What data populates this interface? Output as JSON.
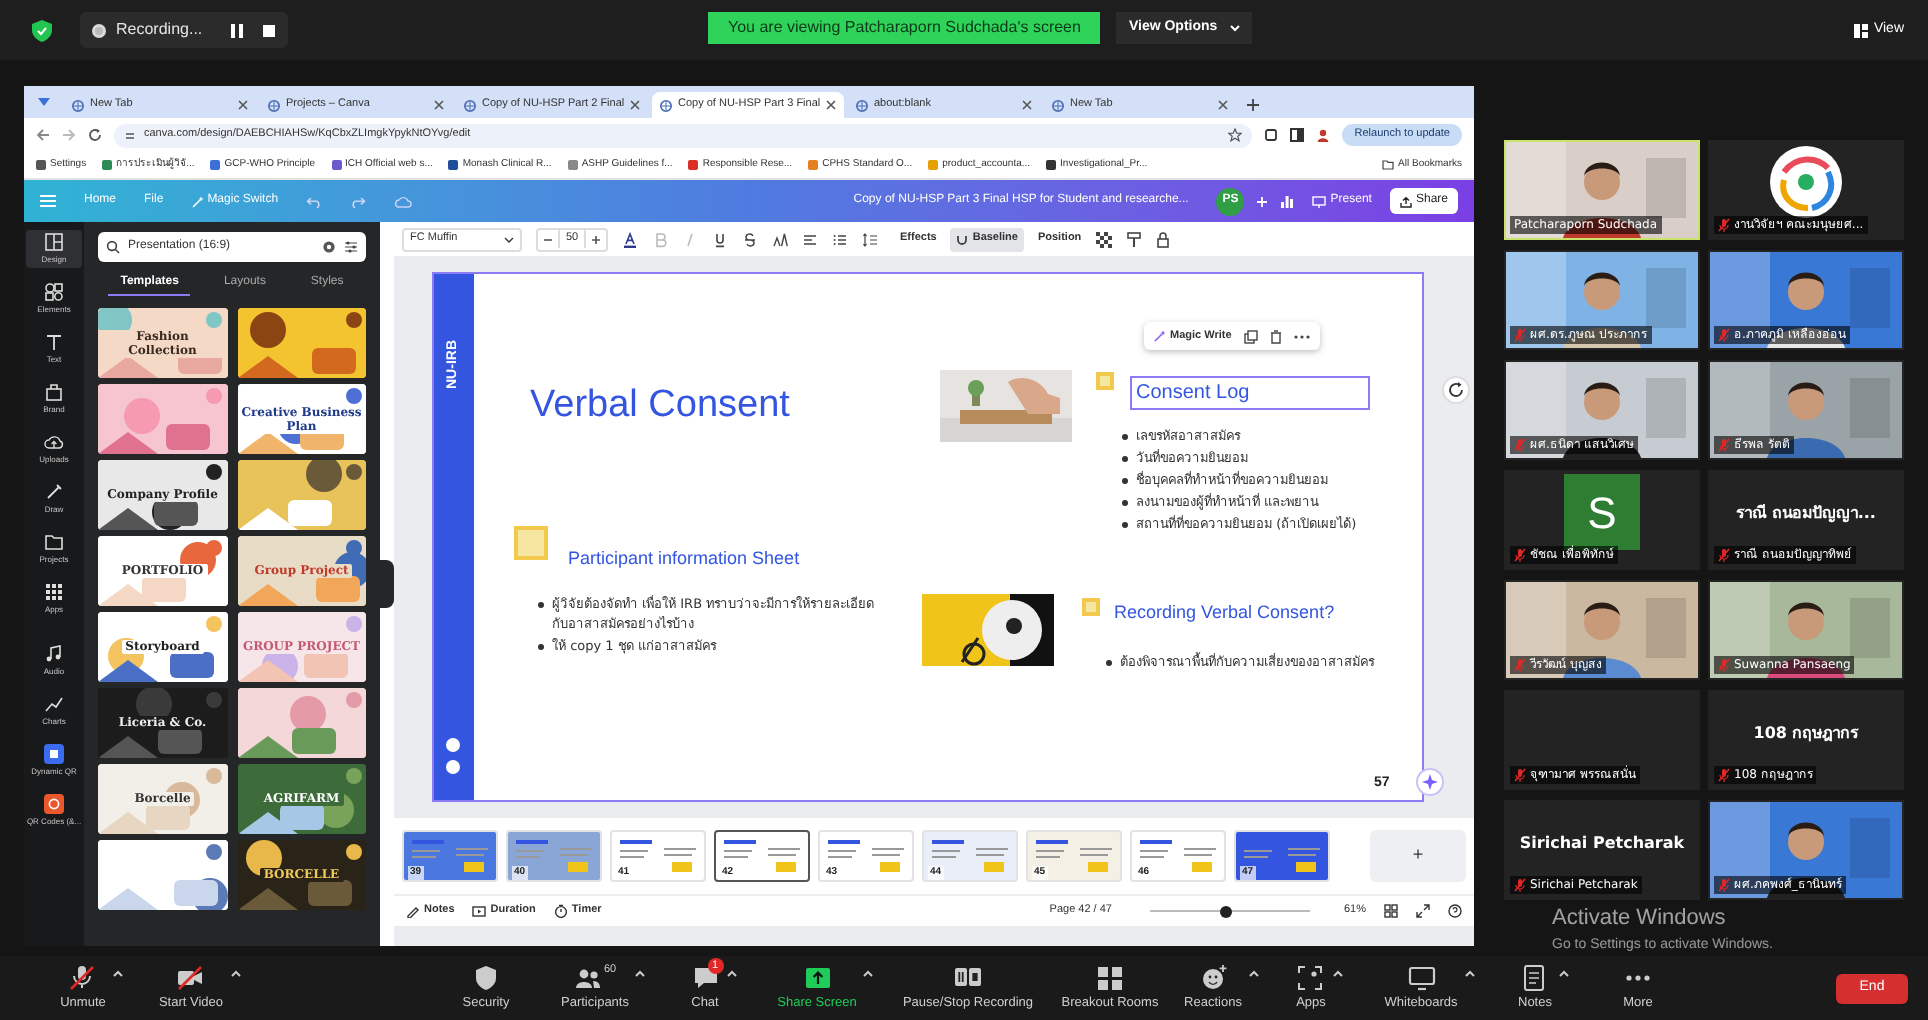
{
  "meeting_bar": {
    "recording": "Recording...",
    "banner": "You are viewing Patcharaporn Sudchada's screen",
    "view_options": "View Options",
    "view": "View"
  },
  "browser": {
    "tabs": [
      {
        "label": "New Tab",
        "selected": false
      },
      {
        "label": "Projects – Canva",
        "selected": false
      },
      {
        "label": "Copy of NU-HSP Part 2 Final",
        "selected": false
      },
      {
        "label": "Copy of NU-HSP Part 3 Final",
        "selected": true
      },
      {
        "label": "about:blank",
        "selected": false
      },
      {
        "label": "New Tab",
        "selected": false
      }
    ],
    "url": "canva.com/design/DAEBCHIAHSw/KqCbxZLImgkYpykNtOYvg/edit",
    "relaunch": "Relaunch to update",
    "bookmarks": [
      "Settings",
      "การประเมินผู้วิจั...",
      "GCP-WHO Principle",
      "ICH Official web s...",
      "Monash Clinical R...",
      "ASHP Guidelines f...",
      "Responsible Rese...",
      "CPHS Standard O...",
      "product_accounta...",
      "Investigational_Pr..."
    ],
    "all_bookmarks": "All Bookmarks"
  },
  "canva": {
    "header": {
      "menu": [
        "Home",
        "File",
        "Magic Switch"
      ],
      "title": "Copy of NU-HSP Part 3 Final HSP for Student and researche...",
      "avatar": "PS",
      "present": "Present",
      "share": "Share"
    },
    "rail": [
      {
        "kind": "design",
        "label": "Design",
        "selected": true
      },
      {
        "kind": "elements",
        "label": "Elements",
        "selected": false
      },
      {
        "kind": "text",
        "label": "Text",
        "selected": false
      },
      {
        "kind": "brand",
        "label": "Brand",
        "selected": false
      },
      {
        "kind": "uploads",
        "label": "Uploads",
        "selected": false
      },
      {
        "kind": "draw",
        "label": "Draw",
        "selected": false
      },
      {
        "kind": "projects",
        "label": "Projects",
        "selected": false
      },
      {
        "kind": "apps",
        "label": "Apps",
        "selected": false
      },
      {
        "kind": "audio",
        "label": "Audio",
        "selected": false
      },
      {
        "kind": "charts",
        "label": "Charts",
        "selected": false
      },
      {
        "kind": "qr",
        "label": "Dynamic QR",
        "selected": false
      },
      {
        "kind": "qrcodes",
        "label": "QR Codes (&...",
        "selected": false
      }
    ],
    "panel": {
      "search": "Presentation (16:9)",
      "tabs": [
        {
          "label": "Templates",
          "selected": true
        },
        {
          "label": "Layouts",
          "selected": false
        },
        {
          "label": "Styles",
          "selected": false
        }
      ],
      "templates": [
        {
          "kind": "titled",
          "title": "Fashion Collection"
        },
        {
          "kind": "picture"
        },
        {
          "kind": "picture"
        },
        {
          "kind": "titled",
          "title": "Creative Business Plan"
        },
        {
          "kind": "titled",
          "title": "Company Profile"
        },
        {
          "kind": "picture"
        },
        {
          "kind": "titled",
          "title": "PORTFOLIO"
        },
        {
          "kind": "titled",
          "title": "Group Project"
        },
        {
          "kind": "titled",
          "title": "Storyboard"
        },
        {
          "kind": "titled",
          "title": "GROUP PROJECT"
        },
        {
          "kind": "titled",
          "title": "Liceria & Co."
        },
        {
          "kind": "picture"
        },
        {
          "kind": "titled",
          "title": "Borcelle"
        },
        {
          "kind": "titled",
          "title": "AGRIFARM"
        },
        {
          "kind": "picture"
        },
        {
          "kind": "titled",
          "title": "BORCELLE"
        }
      ]
    },
    "format_bar": {
      "font": "FC Muffin",
      "size": "50",
      "effects": "Effects",
      "baseline": "Baseline",
      "position": "Position"
    },
    "slide": {
      "side_label": "NU-IRB",
      "title": "Verbal Consent",
      "magic_write": "Magic Write",
      "sections": [
        {
          "heading": "Participant information Sheet",
          "bullets": [
            "ผู้วิจัยต้องจัดทำ เพื่อให้ IRB ทราบว่าจะมีการให้รายละเอียดกับอาสาสมัครอย่างไรบ้าง",
            "ให้ copy 1 ชุด แก่อาสาสมัคร"
          ]
        },
        {
          "heading": "Consent Log",
          "bullets": [
            "เลขรหัสอาสาสมัคร",
            "วันที่ขอความยินยอม",
            "ชื่อบุคคลที่ทำหน้าที่ขอความยินยอม",
            "ลงนามของผู้ที่ทำหน้าที่ และพยาน",
            "สถานที่ที่ขอความยินยอม (ถ้าเปิดเผยได้)"
          ]
        },
        {
          "heading": "Recording Verbal Consent?",
          "bullets": [
            "ต้องพิจารณาพื้นที่กับความเสี่ยงของอาสาสมัคร"
          ]
        }
      ],
      "page_badge": "57"
    },
    "thumbnails": [
      {
        "number": "39",
        "selected": false
      },
      {
        "number": "40",
        "selected": false
      },
      {
        "number": "41",
        "selected": false
      },
      {
        "number": "42",
        "selected": true
      },
      {
        "number": "43",
        "selected": false
      },
      {
        "number": "44",
        "selected": false
      },
      {
        "number": "45",
        "selected": false
      },
      {
        "number": "46",
        "selected": false
      },
      {
        "number": "47",
        "selected": false
      }
    ],
    "add_page": "+",
    "footer": {
      "notes": "Notes",
      "duration": "Duration",
      "timer": "Timer",
      "page": "Page 42 / 47",
      "zoom_slider": {
        "level": 0.47
      },
      "zoom": "61%"
    }
  },
  "gallery": [
    {
      "kind": "video",
      "name": "Patcharaporn Sudchada",
      "muted": false,
      "active_speaker": true
    },
    {
      "kind": "logo",
      "name": "งานวิจัยฯ คณะมนุษยศ...",
      "muted": true,
      "active_speaker": false
    },
    {
      "kind": "video",
      "name": "ผศ.ดร.ภูษณ ประภากร",
      "muted": true,
      "active_speaker": false
    },
    {
      "kind": "video",
      "name": "อ.ภาคภูมิ เหลืองอ่อน",
      "muted": true,
      "active_speaker": false
    },
    {
      "kind": "video",
      "name": "ผศ.ธนิดา แสนวิเศษ",
      "muted": true,
      "active_speaker": false
    },
    {
      "kind": "video",
      "name": "ธีรพล รัตติ",
      "muted": true,
      "active_speaker": false
    },
    {
      "kind": "avatar",
      "initial": "S",
      "name": "ชัชณ เพื่อพิทักษ์",
      "muted": true,
      "active_speaker": false
    },
    {
      "kind": "name",
      "display_name": "ราณี ถนอมปัญญา...",
      "name": "ราณี ถนอมปัญญาทิพย์",
      "muted": true,
      "active_speaker": false
    },
    {
      "kind": "video",
      "name": "วีรวัฒน์ บุญสง",
      "muted": true,
      "active_speaker": false
    },
    {
      "kind": "video",
      "name": "Suwanna Pansaeng",
      "muted": true,
      "active_speaker": false
    },
    {
      "kind": "blank",
      "name": "จุฑามาศ พรรณสนั่น",
      "muted": true,
      "active_speaker": false
    },
    {
      "kind": "name",
      "display_name": "108 กฤษฎากร",
      "name": "108 กฤษฎากร",
      "muted": true,
      "active_speaker": false
    },
    {
      "kind": "name",
      "display_name": "Sirichai Petcharak",
      "name": "Sirichai Petcharak",
      "muted": true,
      "active_speaker": false
    },
    {
      "kind": "video",
      "name": "ผศ.ภคพงศ์_ธานินทร์",
      "muted": true,
      "active_speaker": false
    }
  ],
  "system_notice": {
    "title": "Activate Windows",
    "text": "Go to Settings to activate Windows."
  },
  "toolbar": {
    "items": [
      {
        "kind": "mic",
        "label": "Unmute",
        "off": true,
        "caret": true
      },
      {
        "kind": "camera",
        "label": "Start Video",
        "off": true,
        "caret": true
      },
      {
        "kind": "security",
        "label": "Security",
        "off": false,
        "caret": false
      },
      {
        "kind": "participants",
        "label": "Participants",
        "count": "60",
        "off": false,
        "caret": true
      },
      {
        "kind": "chat",
        "label": "Chat",
        "badge": "1",
        "off": false,
        "caret": true
      },
      {
        "kind": "share",
        "label": "Share Screen",
        "off": false,
        "caret": true,
        "highlight": true
      },
      {
        "kind": "record",
        "label": "Pause/Stop Recording",
        "off": false,
        "caret": false
      },
      {
        "kind": "breakout",
        "label": "Breakout Rooms",
        "off": false,
        "caret": false
      },
      {
        "kind": "reactions",
        "label": "Reactions",
        "off": false,
        "caret": true
      },
      {
        "kind": "apps",
        "label": "Apps",
        "off": false,
        "caret": true
      },
      {
        "kind": "whiteboard",
        "label": "Whiteboards",
        "off": false,
        "caret": true
      },
      {
        "kind": "notes",
        "label": "Notes",
        "off": false,
        "caret": true
      },
      {
        "kind": "more",
        "label": "More",
        "off": false,
        "caret": false
      }
    ],
    "end": "End"
  }
}
